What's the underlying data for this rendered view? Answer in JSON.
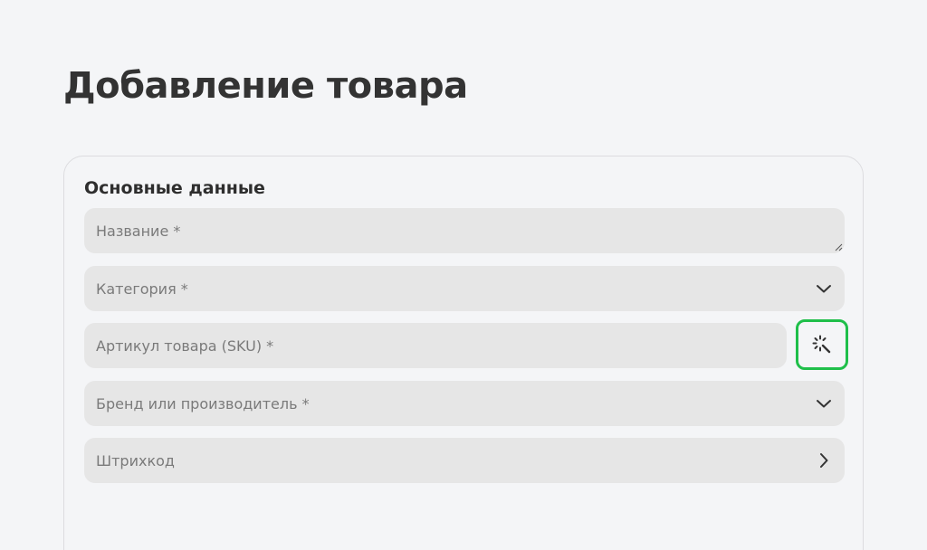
{
  "page": {
    "title": "Добавление товара"
  },
  "form": {
    "section_title": "Основные данные",
    "fields": {
      "name": {
        "placeholder": "Название *"
      },
      "category": {
        "placeholder": "Категория *"
      },
      "sku": {
        "placeholder": "Артикул товара (SKU) *"
      },
      "brand": {
        "placeholder": "Бренд или производитель *"
      },
      "barcode": {
        "placeholder": "Штрихкод"
      }
    }
  },
  "icons": {
    "category_toggle": "chevron-down-icon",
    "sku_generate": "magic-wand-icon",
    "brand_toggle": "chevron-down-icon",
    "barcode_open": "chevron-right-icon"
  },
  "colors": {
    "highlight": "#1fbf4a",
    "field_bg": "#e6e6e6",
    "page_bg": "#f4f5f7"
  }
}
